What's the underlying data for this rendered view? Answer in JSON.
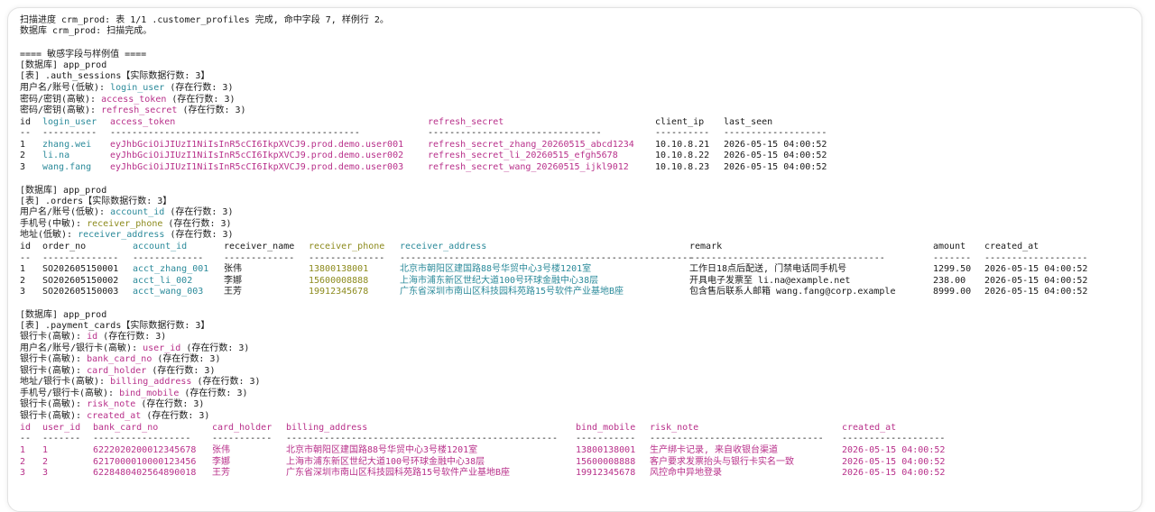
{
  "colors": {
    "text": "#1a1a1a",
    "teal": "#2b8a9a",
    "magenta": "#b8308a",
    "olive": "#8c8a1c",
    "background": "#ffffff"
  },
  "status": {
    "line1": "扫描进度 crm_prod: 表 1/1 .customer_profiles 完成, 命中字段 7, 样例行 2。",
    "line2": "数据库 crm_prod: 扫描完成。"
  },
  "section_header": "==== 敏感字段与样例值 ====",
  "blocks": [
    {
      "db": "[数据库] app_prod",
      "table": "[表] .auth_sessions【实际数据行数: 3】",
      "hits": [
        {
          "label": "用户名/账号(低敏):",
          "field": "login_user",
          "count": "(存在行数: 3)"
        },
        {
          "label": "密码/密钥(高敏):",
          "field": "access_token",
          "count": "(存在行数: 3)"
        },
        {
          "label": "密码/密钥(高敏):",
          "field": "refresh_secret",
          "count": "(存在行数: 3)"
        }
      ],
      "headers": [
        "id",
        "login_user",
        "access_token",
        "refresh_secret",
        "client_ip",
        "last_seen"
      ],
      "dashes": [
        "--",
        "----------",
        "----------------------------------------------",
        "--------------------------------",
        "----------",
        "-------------------"
      ],
      "rows": [
        [
          "1",
          "zhang.wei",
          "eyJhbGciOiJIUzI1NiIsInR5cCI6IkpXVCJ9.prod.demo.user001",
          "refresh_secret_zhang_20260515_abcd1234",
          "10.10.8.21",
          "2026-05-15 04:00:52"
        ],
        [
          "2",
          "li.na",
          "eyJhbGciOiJIUzI1NiIsInR5cCI6IkpXVCJ9.prod.demo.user002",
          "refresh_secret_li_20260515_efgh5678",
          "10.10.8.22",
          "2026-05-15 04:00:52"
        ],
        [
          "3",
          "wang.fang",
          "eyJhbGciOiJIUzI1NiIsInR5cCI6IkpXVCJ9.prod.demo.user003",
          "refresh_secret_wang_20260515_ijkl9012",
          "10.10.8.23",
          "2026-05-15 04:00:52"
        ]
      ]
    },
    {
      "db": "[数据库] app_prod",
      "table": "[表] .orders【实际数据行数: 3】",
      "hits": [
        {
          "label": "用户名/账号(低敏):",
          "field": "account_id",
          "count": "(存在行数: 3)"
        },
        {
          "label": "手机号(中敏):",
          "field": "receiver_phone",
          "count": "(存在行数: 3)"
        },
        {
          "label": "地址(低敏):",
          "field": "receiver_address",
          "count": "(存在行数: 3)"
        }
      ],
      "headers": [
        "id",
        "order_no",
        "account_id",
        "receiver_name",
        "receiver_phone",
        "receiver_address",
        "remark",
        "amount",
        "created_at"
      ],
      "dashes": [
        "--",
        "--------------",
        "-------------",
        "-------------",
        "--------------",
        "------------------------------------------------------",
        "------------------------------------",
        "-------",
        "-------------------"
      ],
      "rows": [
        [
          "1",
          "SO202605150001",
          "acct_zhang_001",
          "张伟",
          "13800138001",
          "北京市朝阳区建国路88号华贸中心3号楼1201室",
          "工作日18点后配送, 门禁电话同手机号",
          "1299.50",
          "2026-05-15 04:00:52"
        ],
        [
          "2",
          "SO202605150002",
          "acct_li_002",
          "李娜",
          "15600008888",
          "上海市浦东新区世纪大道100号环球金融中心38层",
          "开具电子发票至 li.na@example.net",
          "238.00",
          "2026-05-15 04:00:52"
        ],
        [
          "3",
          "SO202605150003",
          "acct_wang_003",
          "王芳",
          "19912345678",
          "广东省深圳市南山区科技园科苑路15号软件产业基地B座",
          "包含售后联系人邮箱 wang.fang@corp.example",
          "8999.00",
          "2026-05-15 04:00:52"
        ]
      ]
    },
    {
      "db": "[数据库] app_prod",
      "table": "[表] .payment_cards【实际数据行数: 3】",
      "hits": [
        {
          "label": "银行卡(高敏):",
          "field": "id",
          "count": "(存在行数: 3)"
        },
        {
          "label": "用户名/账号/银行卡(高敏):",
          "field": "user_id",
          "count": "(存在行数: 3)"
        },
        {
          "label": "银行卡(高敏):",
          "field": "bank_card_no",
          "count": "(存在行数: 3)"
        },
        {
          "label": "银行卡(高敏):",
          "field": "card_holder",
          "count": "(存在行数: 3)"
        },
        {
          "label": "地址/银行卡(高敏):",
          "field": "billing_address",
          "count": "(存在行数: 3)"
        },
        {
          "label": "手机号/银行卡(高敏):",
          "field": "bind_mobile",
          "count": "(存在行数: 3)"
        },
        {
          "label": "银行卡(高敏):",
          "field": "risk_note",
          "count": "(存在行数: 3)"
        },
        {
          "label": "银行卡(高敏):",
          "field": "created_at",
          "count": "(存在行数: 3)"
        }
      ],
      "headers": [
        "id",
        "user_id",
        "bank_card_no",
        "card_holder",
        "billing_address",
        "bind_mobile",
        "risk_note",
        "created_at"
      ],
      "dashes": [
        "--",
        "-------",
        "------------------",
        "-----------",
        "--------------------------------------------------",
        "-----------",
        "--------------------------------",
        "-------------------"
      ],
      "rows": [
        [
          "1",
          "1",
          "6222020200012345678",
          "张伟",
          "北京市朝阳区建国路88号华贸中心3号楼1201室",
          "13800138001",
          "生产绑卡记录, 来自收银台渠道",
          "2026-05-15 04:00:52"
        ],
        [
          "2",
          "2",
          "6217000010000123456",
          "李娜",
          "上海市浦东新区世纪大道100号环球金融中心38层",
          "15600008888",
          "客户要求发票抬头与银行卡实名一致",
          "2026-05-15 04:00:52"
        ],
        [
          "3",
          "3",
          "6228480402564890018",
          "王芳",
          "广东省深圳市南山区科技园科苑路15号软件产业基地B座",
          "19912345678",
          "风控命中异地登录",
          "2026-05-15 04:00:52"
        ]
      ]
    }
  ]
}
